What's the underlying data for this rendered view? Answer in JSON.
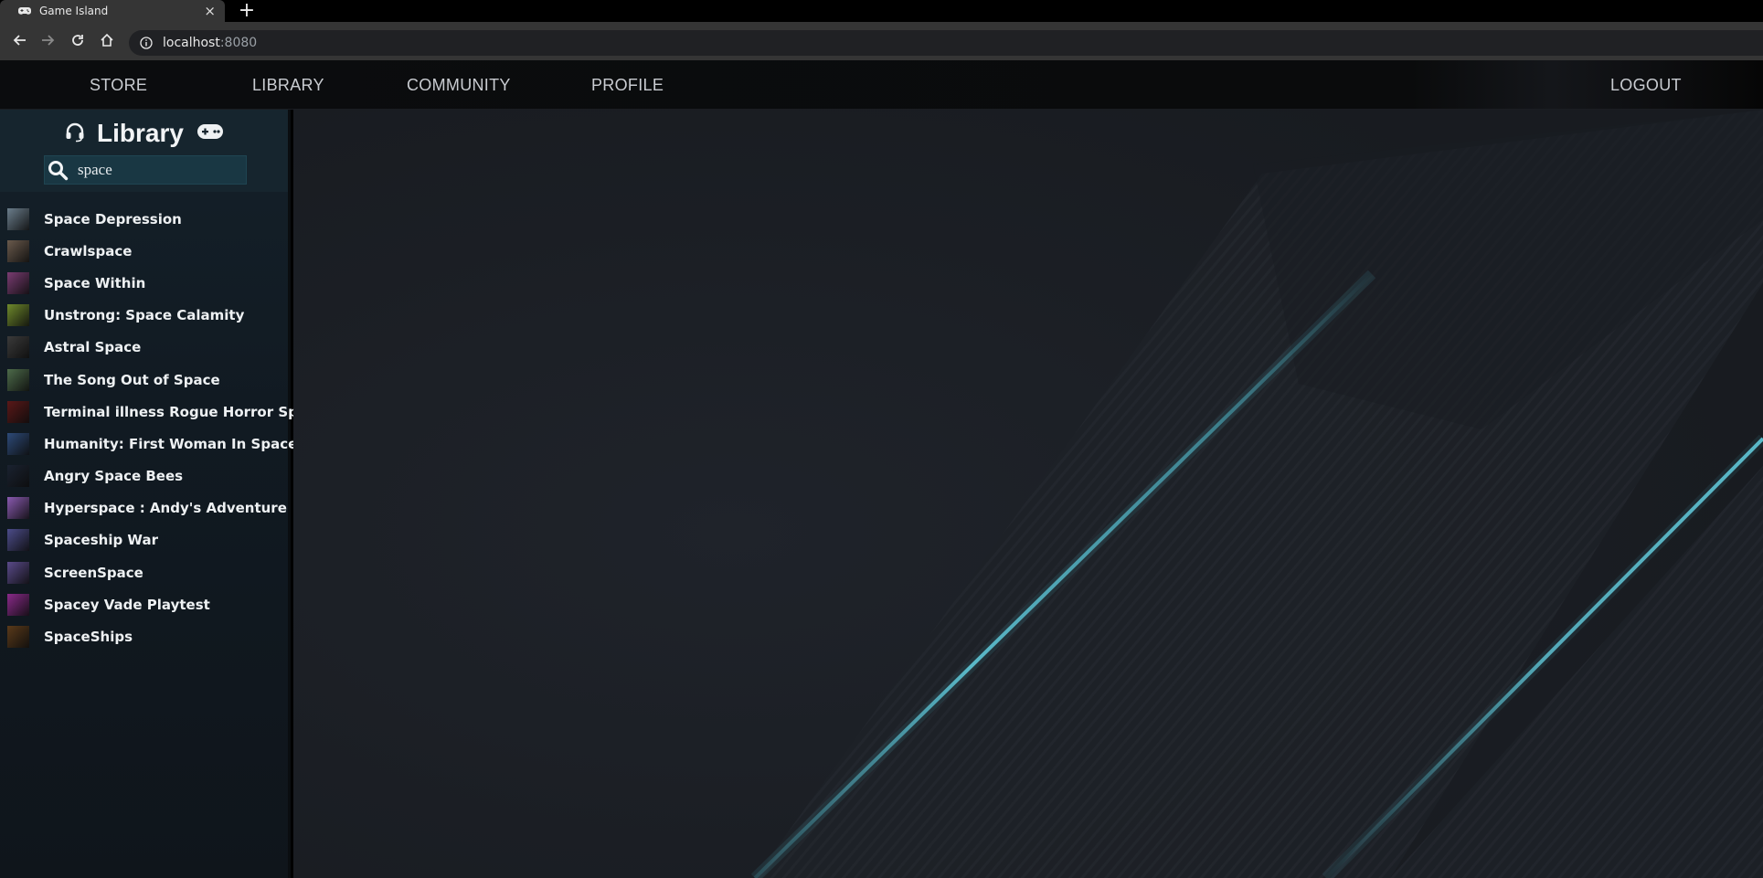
{
  "browser": {
    "tab_title": "Game Island",
    "new_tab_label": "+",
    "close_label": "×",
    "url_host": "localhost",
    "url_port": ":8080"
  },
  "nav": {
    "store": "STORE",
    "library": "LIBRARY",
    "community": "COMMUNITY",
    "profile": "PROFILE",
    "logout": "LOGOUT"
  },
  "sidebar": {
    "title": "Library",
    "search_value": "space",
    "icons": [
      "headset-icon",
      "gamepad-icon",
      "search-icon"
    ],
    "games": [
      {
        "name": "Space Depression",
        "color": "#6b7e8c"
      },
      {
        "name": "Crawlspace",
        "color": "#6a5a4c"
      },
      {
        "name": "Space Within",
        "color": "#7a3c72"
      },
      {
        "name": "Unstrong: Space Calamity",
        "color": "#6f8a2c"
      },
      {
        "name": "Astral Space",
        "color": "#3a3a3a"
      },
      {
        "name": "The Song Out of Space",
        "color": "#4d6b4a"
      },
      {
        "name": "Terminal illness Rogue Horror Space",
        "color": "#5a1818"
      },
      {
        "name": "Humanity: First Woman In Space",
        "color": "#2d4a78"
      },
      {
        "name": "Angry Space Bees",
        "color": "#1a2230"
      },
      {
        "name": "Hyperspace : Andy's Adventure",
        "color": "#8a5ab0"
      },
      {
        "name": "Spaceship War",
        "color": "#4c4c8a"
      },
      {
        "name": "ScreenSpace",
        "color": "#5a4a8a"
      },
      {
        "name": "Spacey Vade Playtest",
        "color": "#8a2a8a"
      },
      {
        "name": "SpaceShips",
        "color": "#5a3a1a"
      }
    ]
  },
  "colors": {
    "accent": "#4fb3c4",
    "sidebar_bg": "#111a22",
    "main_bg": "#1b1e24"
  }
}
